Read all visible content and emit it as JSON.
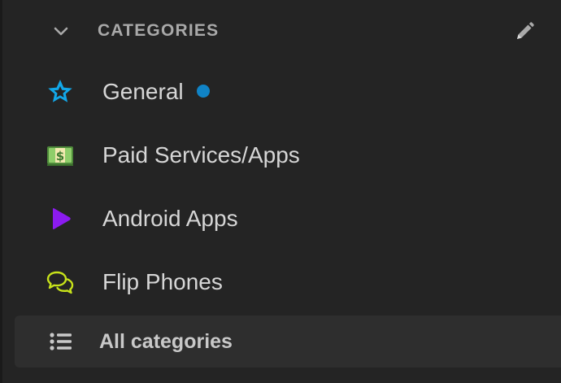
{
  "section": {
    "title": "CATEGORIES",
    "collapse_icon": "chevron-down-icon",
    "edit_icon": "pencil-icon"
  },
  "categories": [
    {
      "label": "General",
      "icon": "star-badge-icon",
      "icon_color": "#12a7e8",
      "unread": true,
      "unread_color": "#1083c6"
    },
    {
      "label": "Paid Services/Apps",
      "icon": "money-bill-icon",
      "icon_color": "#6aa84f",
      "unread": false
    },
    {
      "label": "Android Apps",
      "icon": "play-triangle-icon",
      "icon_color": "#8b1bf0",
      "unread": false
    },
    {
      "label": "Flip Phones",
      "icon": "chat-bubbles-icon",
      "icon_color": "#c8e31a",
      "unread": false
    }
  ],
  "all_categories": {
    "label": "All categories",
    "icon": "list-icon"
  },
  "colors": {
    "background": "#242424",
    "text": "#d6d6d6",
    "header_text": "#a9a9a9",
    "selected_row": "#2e2e2e"
  }
}
